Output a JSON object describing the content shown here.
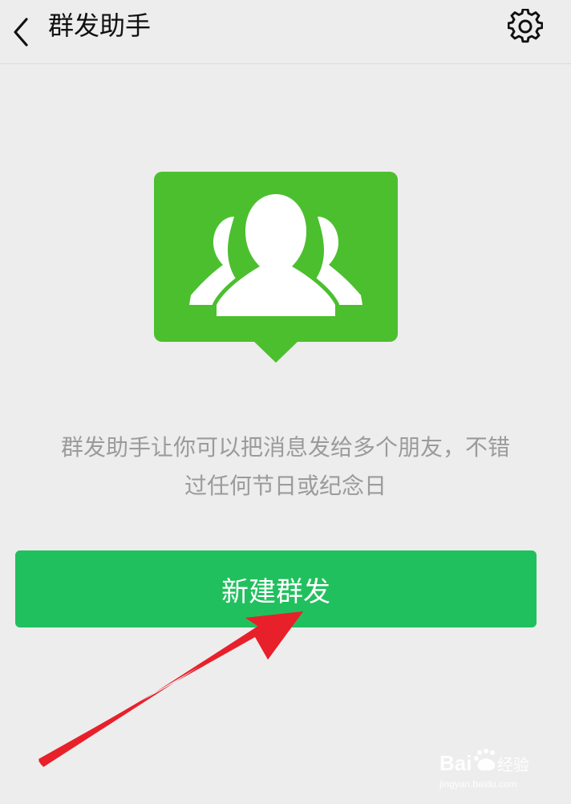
{
  "header": {
    "title": "群发助手",
    "back_icon": "chevron-left-icon",
    "settings_icon": "gear-icon"
  },
  "description": {
    "line1": "群发助手让你可以把消息发给多个朋友，不错",
    "line2": "过任何节日或纪念日"
  },
  "primary_button": {
    "label": "新建群发"
  },
  "watermark": {
    "logo_text": "Baidu经验",
    "url": "jingyan.baidu.com"
  },
  "colors": {
    "background": "#EDEDED",
    "button_green": "#21C05E",
    "illustration_green": "#4CBF2F",
    "annotation_red": "#E8202A"
  }
}
